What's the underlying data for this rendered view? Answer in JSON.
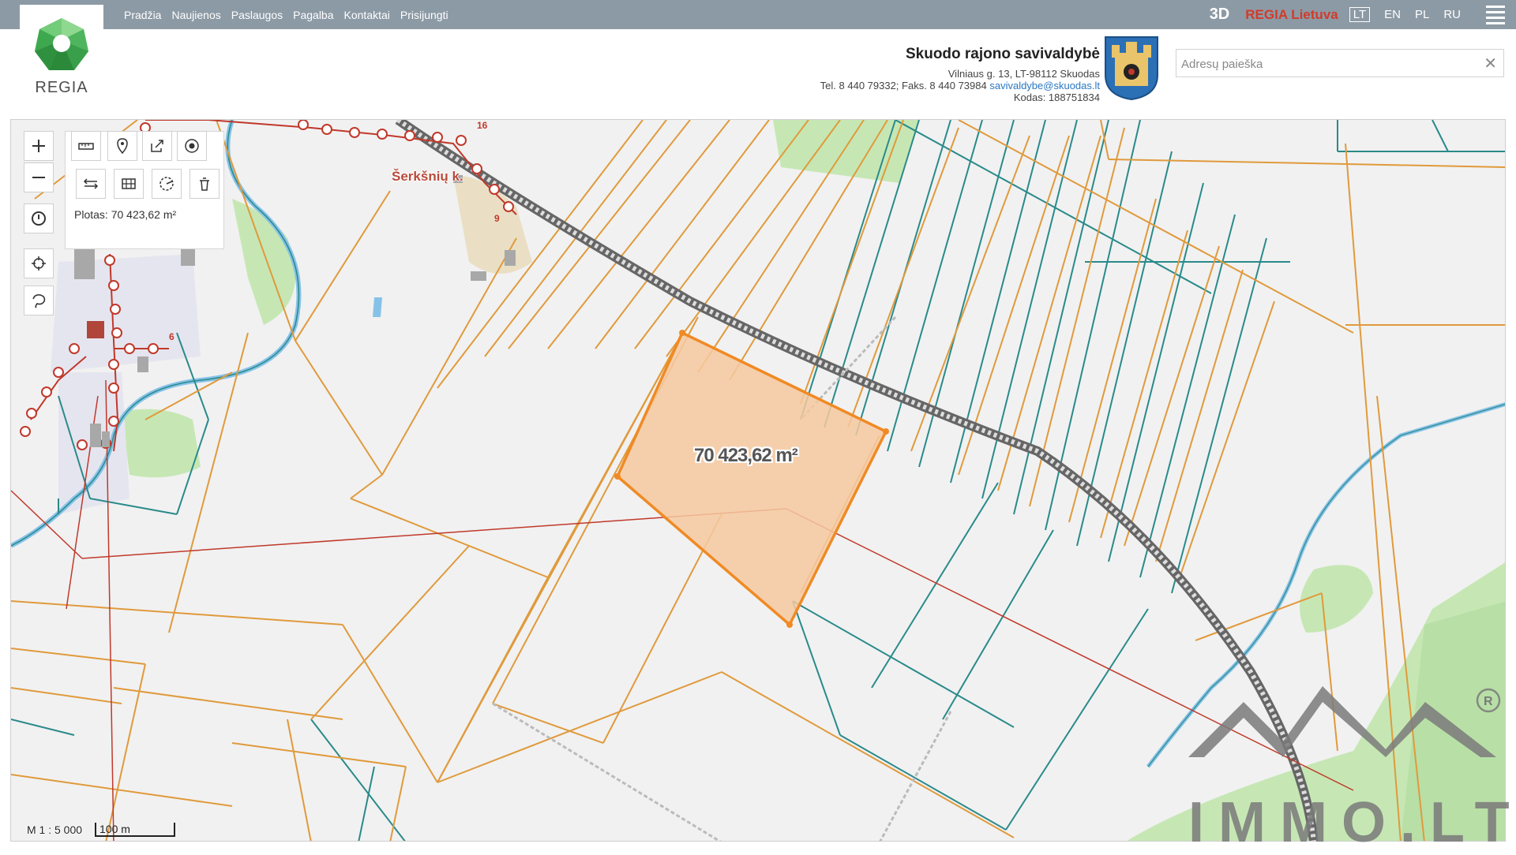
{
  "nav": {
    "items": [
      "Pradžia",
      "Naujienos",
      "Paslaugos",
      "Pagalba",
      "Kontaktai",
      "Prisijungti"
    ],
    "btn_3d": "3D",
    "regia_region": "REGIA Lietuva",
    "languages": [
      "LT",
      "EN",
      "PL",
      "RU"
    ],
    "active_language": "LT"
  },
  "logo": {
    "text": "REGIA"
  },
  "municipality": {
    "name": "Skuodo rajono savivaldybė",
    "address": "Vilniaus g. 13, LT-98112 Skuodas",
    "phone": "Tel. 8 440 79332; Faks. 8 440 73984",
    "email": "savivaldybe@skuodas.lt",
    "code": "Kodas: 188751834"
  },
  "search": {
    "placeholder": "Adresų paieška",
    "clear_icon": "close-icon"
  },
  "map": {
    "measure_result": "Plotas: 70 423,62 m²",
    "area_label": "70 423,62 m²",
    "place_name": "Šerkšnių k.",
    "house_numbers": [
      "16",
      "9",
      "6"
    ],
    "scale_ratio": "M 1 : 5 000",
    "scale_bar": "100 m"
  },
  "watermark": {
    "text": "IMMO.LT"
  },
  "colors": {
    "topbar": "#8c9aa5",
    "parcel_orange": "#e09a3c",
    "parcel_teal": "#2a8a8a",
    "selection_fill": "#f6c9a0",
    "selection_stroke": "#f08a24",
    "forest_green": "#c6e7b4",
    "river_blue": "#86c2e8"
  },
  "icons": {
    "zoom_in": "plus-icon",
    "zoom_out": "minus-icon",
    "history": "clock-icon",
    "locate": "crosshair-icon",
    "lasso": "lasso-icon"
  }
}
